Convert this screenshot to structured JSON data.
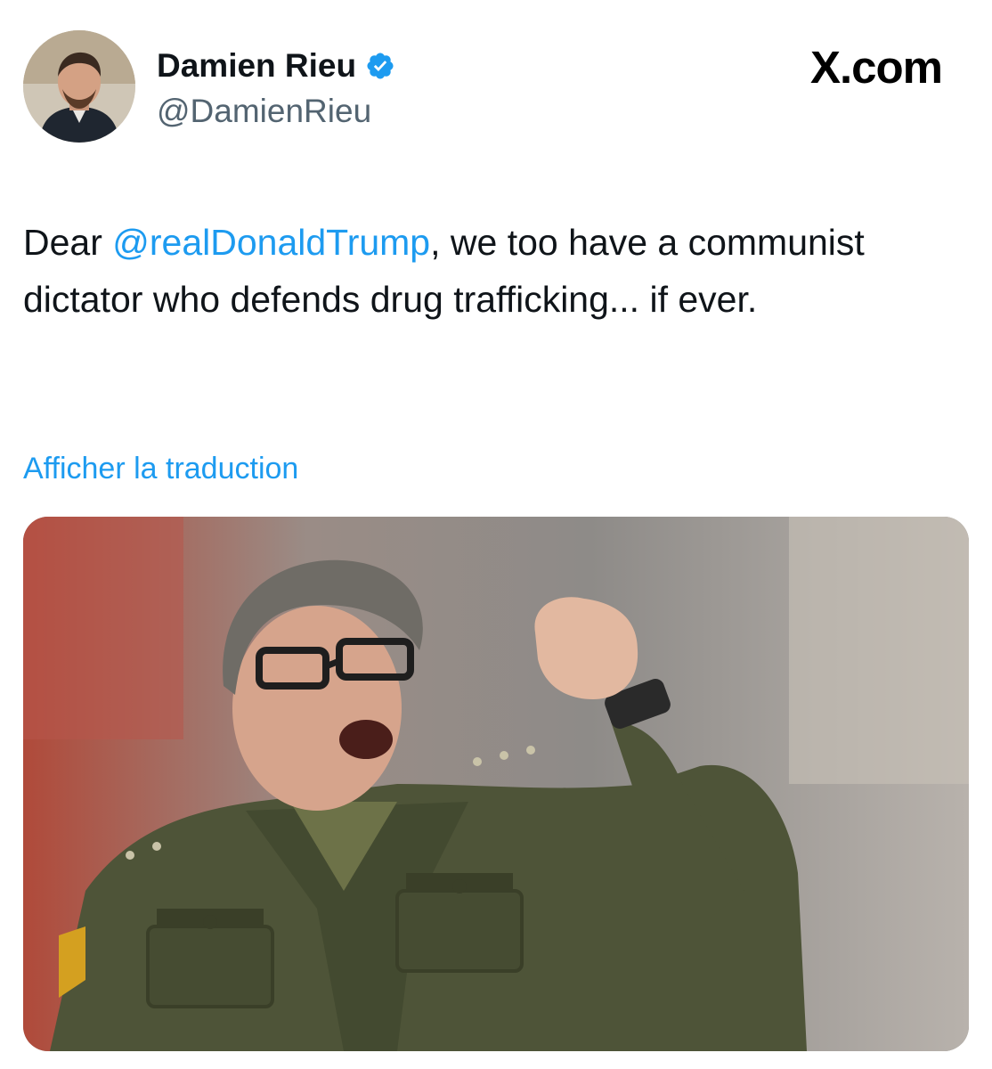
{
  "author": {
    "display_name": "Damien Rieu",
    "handle": "@DamienRieu",
    "verified": true,
    "avatar_icon": "profile-photo"
  },
  "brand": {
    "label": "X.com"
  },
  "tweet": {
    "text_before": "Dear ",
    "mention": "@realDonaldTrump",
    "text_after": ", we too have a communist dictator who defends drug trafficking... if ever."
  },
  "translate": {
    "label": "Afficher la traduction"
  },
  "media": {
    "description_icon": "photo-man-military-uniform-raised-fist"
  },
  "colors": {
    "link": "#1d9bf0",
    "verified": "#1d9bf0",
    "text": "#0f1419",
    "secondary": "#536471"
  }
}
